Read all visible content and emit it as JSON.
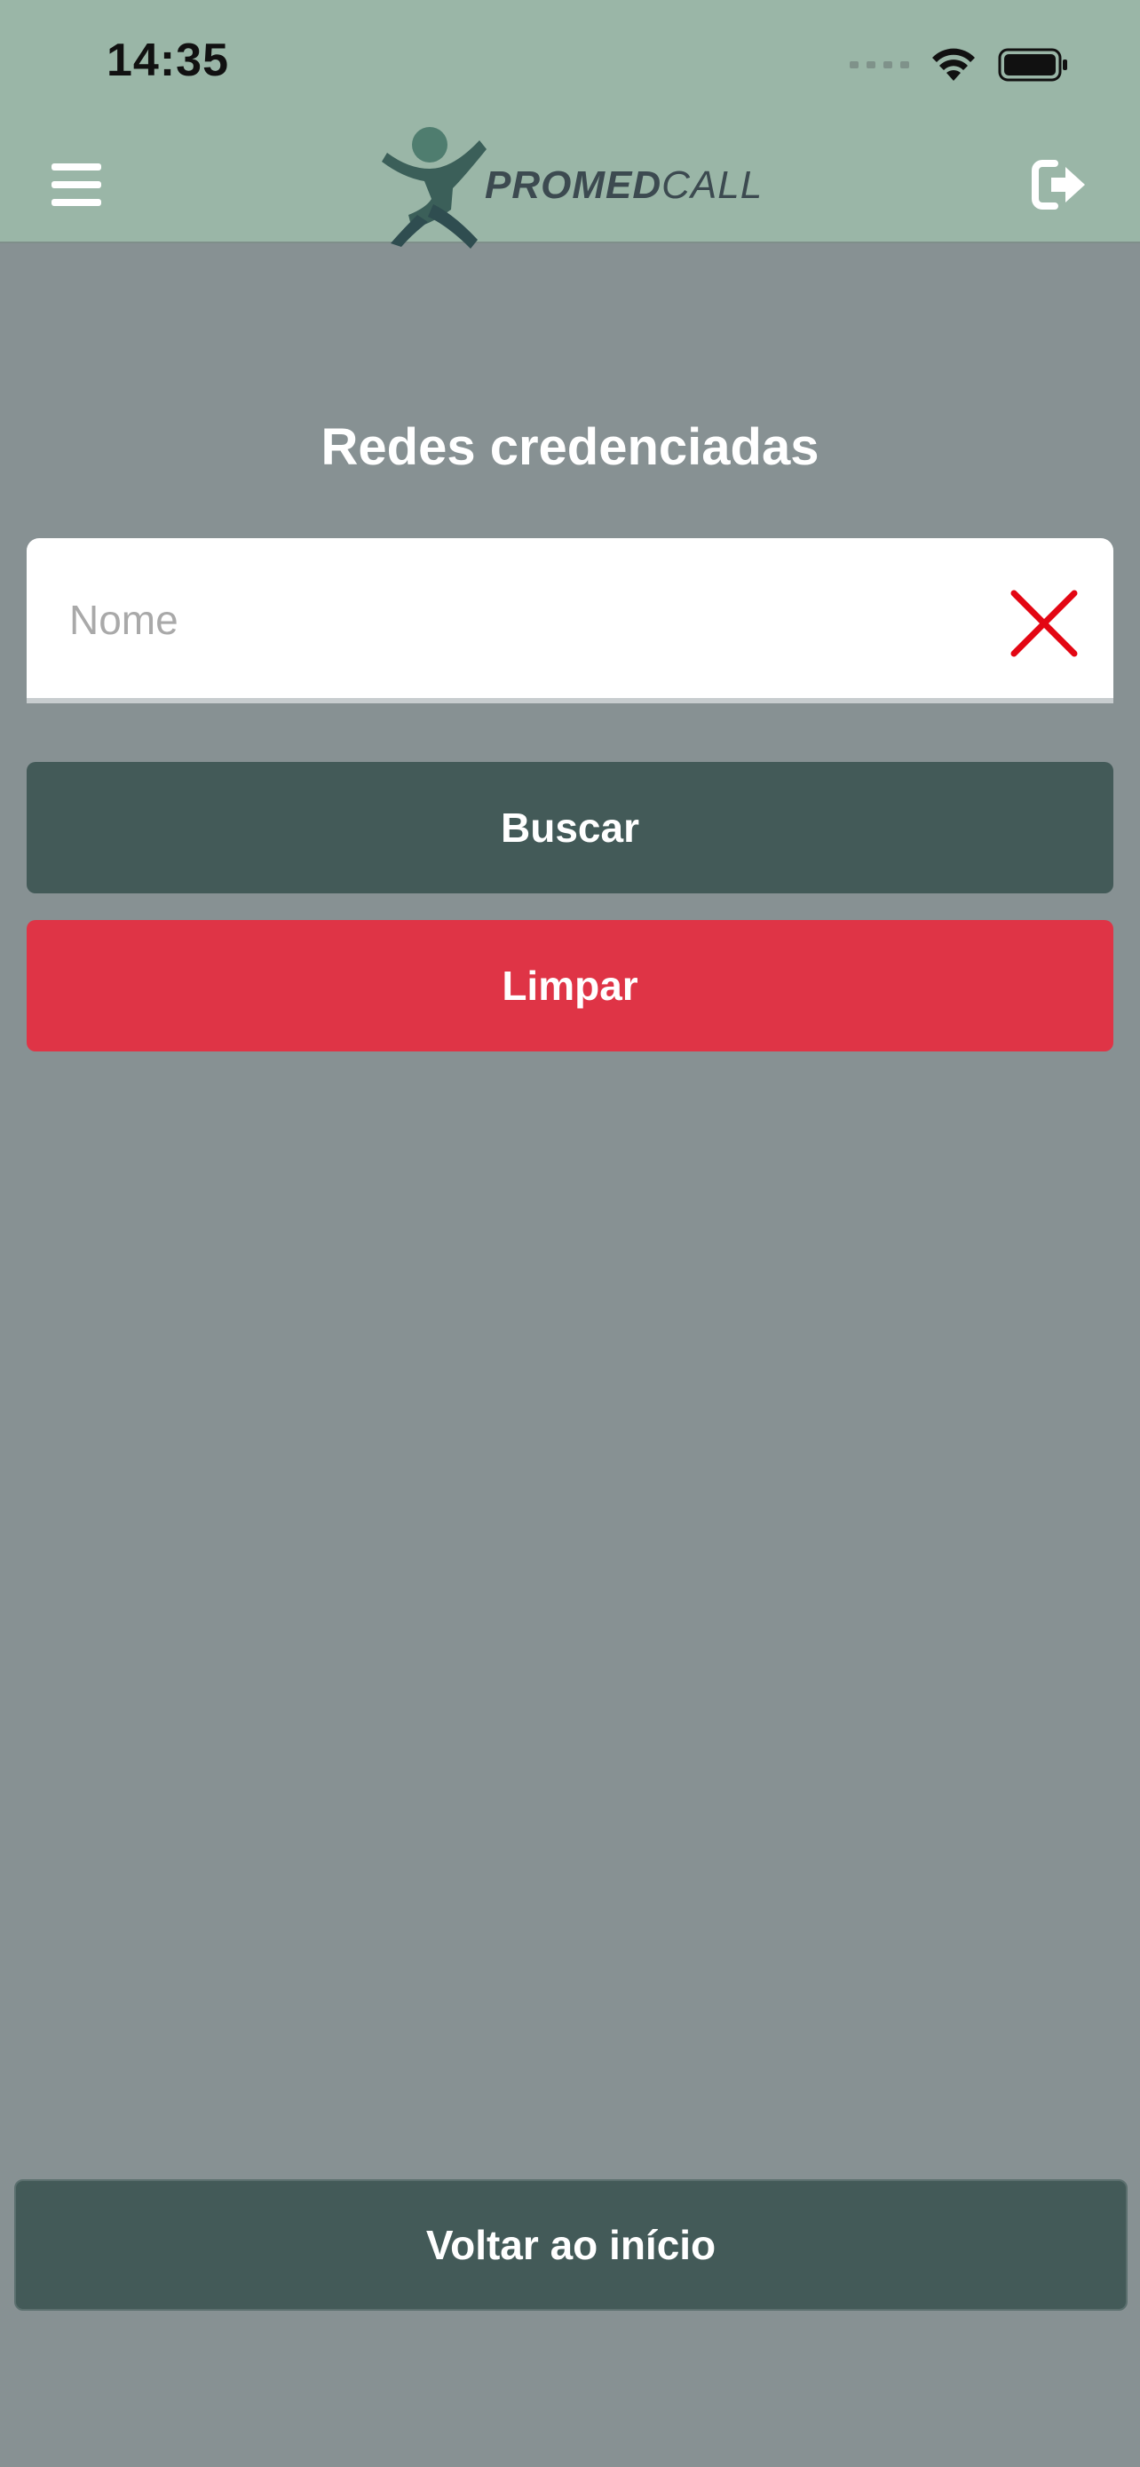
{
  "status_bar": {
    "time": "14:35"
  },
  "header": {
    "brand_bold": "PROMED",
    "brand_light": "CALL",
    "colors": {
      "background": "#9ab6a7",
      "logo_figure": "#4a6b66"
    }
  },
  "page": {
    "title": "Redes credenciadas",
    "background": "#879193"
  },
  "search": {
    "placeholder": "Nome",
    "value": "",
    "clear_icon": "close-icon",
    "clear_icon_color": "#e30613"
  },
  "actions": {
    "search_label": "Buscar",
    "search_color": "#435a58",
    "clear_label": "Limpar",
    "clear_color": "#df3446",
    "back_label": "Voltar ao início",
    "back_color": "#435a58"
  },
  "icons": {
    "menu": "hamburger-menu-icon",
    "logout": "sign-out-icon",
    "wifi": "wifi-icon",
    "battery": "battery-icon",
    "signal": "cellular-signal-icon"
  }
}
